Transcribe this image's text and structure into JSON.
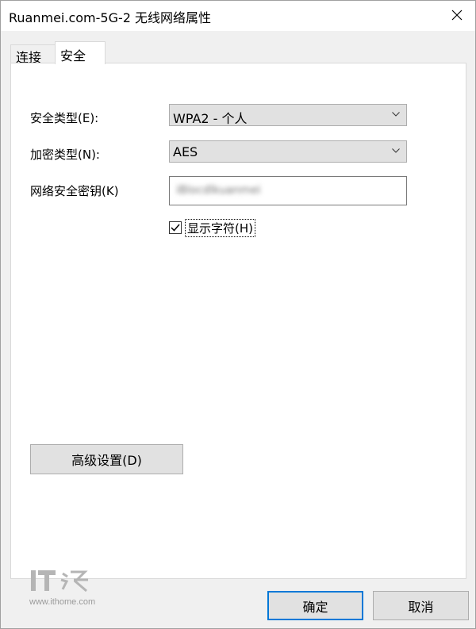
{
  "window": {
    "title": "Ruanmei.com-5G-2 无线网络属性"
  },
  "tabs": [
    {
      "label": "连接",
      "active": false
    },
    {
      "label": "安全",
      "active": true
    }
  ],
  "form": {
    "security_type_label": "安全类型(E):",
    "security_type_value": "WPA2 - 个人",
    "encryption_type_label": "加密类型(N):",
    "encryption_type_value": "AES",
    "network_key_label": "网络安全密钥(K)",
    "network_key_value": "iBlocdlkuanmei",
    "show_chars_label": "显示字符(H)",
    "show_chars_checked": true
  },
  "buttons": {
    "advanced": "高级设置(D)",
    "ok": "确定",
    "cancel": "取消"
  },
  "watermark": {
    "logo": "IT之家",
    "url": "www.ithome.com"
  },
  "colors": {
    "accent": "#0078d7",
    "button_bg": "#e1e1e1",
    "panel_bg": "#ffffff",
    "window_bg": "#f0f0f0"
  },
  "icons": {
    "close": "close-icon",
    "dropdown": "chevron-down-icon",
    "check": "checkmark-icon"
  }
}
